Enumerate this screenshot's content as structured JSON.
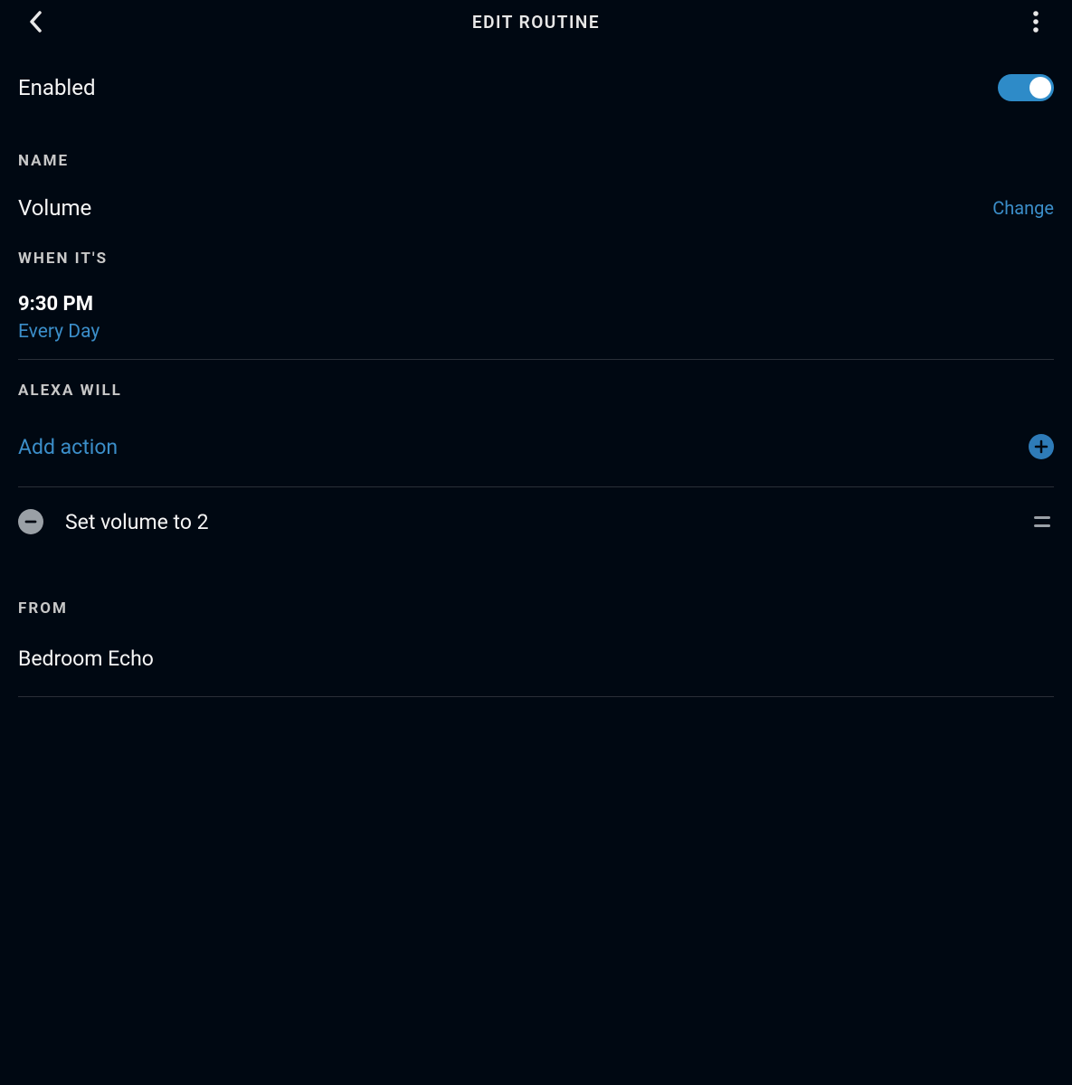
{
  "header": {
    "title": "EDIT ROUTINE"
  },
  "enabled": {
    "label": "Enabled",
    "state": true
  },
  "sections": {
    "name": {
      "label": "NAME",
      "value": "Volume",
      "change_label": "Change"
    },
    "when": {
      "label": "WHEN IT'S",
      "time": "9:30 PM",
      "repeat": "Every Day"
    },
    "alexa_will": {
      "label": "ALEXA WILL",
      "add_action_label": "Add action",
      "actions": [
        {
          "text": "Set volume to 2"
        }
      ]
    },
    "from": {
      "label": "FROM",
      "device": "Bedroom Echo"
    }
  },
  "colors": {
    "accent": "#3b8ec9",
    "toggle": "#2e8bc8"
  }
}
